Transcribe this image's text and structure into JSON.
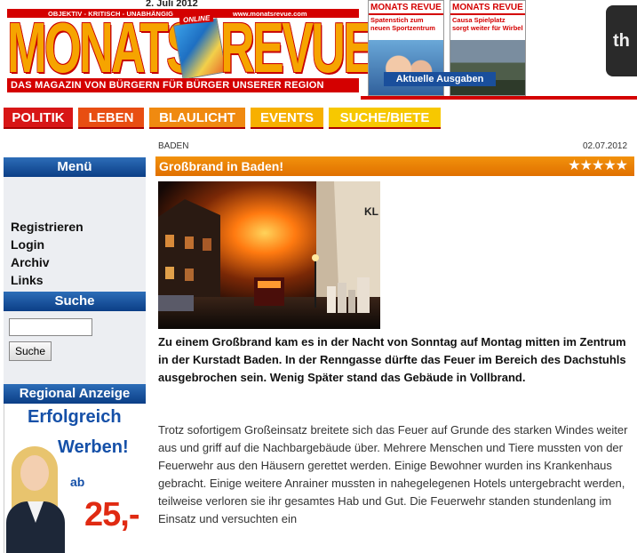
{
  "header": {
    "date": "2. Juli 2012",
    "logo_left": "MONATS",
    "logo_right": "REVUE",
    "logo_badge": "ONLINE",
    "tagline_top": "OBJEKTIV - KRITISCH - UNABHÄNGIG",
    "website": "www.monatsrevue.com",
    "tagline_bottom": "DAS MAGAZIN VON BÜRGERN FÜR BÜRGER UNSERER REGION",
    "covers": [
      {
        "masthead": "MONATS REVUE",
        "headline": "Spatenstich zum neuen Sportzentrum"
      },
      {
        "masthead": "MONATS REVUE",
        "headline": "Causa Spielplatz sorgt weiter für Wirbel"
      }
    ],
    "covers_button": "Aktuelle Ausgaben",
    "ad_right_text": "th"
  },
  "nav": {
    "items": [
      {
        "label": "POLITIK",
        "color": "#d81616"
      },
      {
        "label": "LEBEN",
        "color": "#e84e12"
      },
      {
        "label": "BLAULICHT",
        "color": "#f08a10"
      },
      {
        "label": "EVENTS",
        "color": "#f7b000"
      },
      {
        "label": "SUCHE/BIETE",
        "color": "#f7c800"
      }
    ]
  },
  "sidebar": {
    "menu_title": "Menü",
    "menu_items": [
      "Registrieren",
      "Login",
      "Archiv",
      "Links"
    ],
    "search_title": "Suche",
    "search_value": "",
    "search_button": "Suche",
    "regional_title": "Regional Anzeige",
    "ad": {
      "line1": "Erfolgreich",
      "line2": "Werben!",
      "prefix": "ab",
      "price": "25,-"
    }
  },
  "article": {
    "category": "BADEN",
    "date": "02.07.2012",
    "title": "Großbrand in Baden!",
    "rating_stars": 5,
    "photo_sign": "KL",
    "lead": "Zu einem Großbrand kam es in der Nacht von Sonntag auf Montag mitten im Zentrum in der Kurstadt Baden. In der Renngasse dürfte das Feuer im Bereich des Dachstuhls ausgebrochen sein. Wenig Später stand das Gebäude in Vollbrand.",
    "body": "Trotz sofortigem Großeinsatz breitete sich das Feuer auf Grunde des starken Windes weiter aus und griff auf die Nachbargebäude über. Mehrere Menschen und Tiere mussten von der Feuerwehr aus den Häusern gerettet werden. Einige Bewohner wurden ins Krankenhaus gebracht. Einige weitere Anrainer mussten in nahegelegenen Hotels untergebracht werden, teilweise verloren sie ihr gesamtes Hab und Gut. Die Feuerwehr standen stundenlang im Einsatz und versuchten ein"
  },
  "colors": {
    "brand_red": "#d40000",
    "brand_orange": "#f6a400",
    "sidebar_blue": "#0b3e86",
    "article_header_orange": "#e07000"
  }
}
